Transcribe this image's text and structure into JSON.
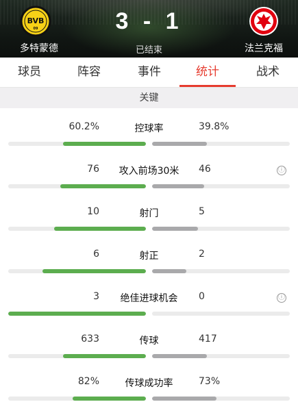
{
  "match": {
    "home_team": "多特蒙德",
    "away_team": "法兰克福",
    "score": "3 - 1",
    "status": "已结束"
  },
  "tabs": [
    {
      "label": "球员",
      "active": false
    },
    {
      "label": "阵容",
      "active": false
    },
    {
      "label": "事件",
      "active": false
    },
    {
      "label": "统计",
      "active": true
    },
    {
      "label": "战术",
      "active": false
    }
  ],
  "section": {
    "title": "关键"
  },
  "stats": [
    {
      "label": "控球率",
      "home": "60.2%",
      "away": "39.8%",
      "home_share": 0.602,
      "away_share": 0.398,
      "info": false
    },
    {
      "label": "攻入前场30米",
      "home": "76",
      "away": "46",
      "home_share": 0.62,
      "away_share": 0.38,
      "info": true
    },
    {
      "label": "射门",
      "home": "10",
      "away": "5",
      "home_share": 0.667,
      "away_share": 0.333,
      "info": false
    },
    {
      "label": "射正",
      "home": "6",
      "away": "2",
      "home_share": 0.75,
      "away_share": 0.25,
      "info": false
    },
    {
      "label": "绝佳进球机会",
      "home": "3",
      "away": "0",
      "home_share": 1.0,
      "away_share": 0.0,
      "info": true
    },
    {
      "label": "传球",
      "home": "633",
      "away": "417",
      "home_share": 0.603,
      "away_share": 0.397,
      "info": false
    },
    {
      "label": "传球成功率",
      "home": "82%",
      "away": "73%",
      "home_share": 0.53,
      "away_share": 0.47,
      "info": false
    }
  ],
  "info_icon": "ⓘ",
  "colors": {
    "accent": "#e63b2e",
    "home_bar": "#5cad4f",
    "away_bar": "#a9a9ab"
  }
}
